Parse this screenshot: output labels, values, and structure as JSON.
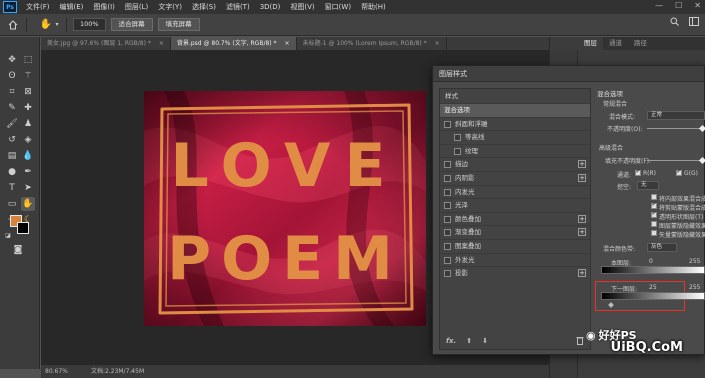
{
  "menubar": {
    "logo": "Ps",
    "items": [
      "文件(F)",
      "编辑(E)",
      "图像(I)",
      "图层(L)",
      "文字(Y)",
      "选择(S)",
      "滤镜(T)",
      "3D(D)",
      "视图(V)",
      "窗口(W)",
      "帮助(H)"
    ],
    "controls": [
      "—",
      "☐",
      "✕"
    ]
  },
  "options": {
    "zoom_value": "100%",
    "fit_screen": "适合屏幕",
    "fill_screen": "填充屏幕"
  },
  "tabs": [
    {
      "label": "美女.jpg @ 97.6% (图层 1, RGB/8) *",
      "close": "×",
      "active": false
    },
    {
      "label": "背景.psd @ 80.7% (文字, RGB/8) *",
      "close": "×",
      "active": true
    },
    {
      "label": "未标题-1 @ 100% (Lorem Ipsum, RGB/8) *",
      "close": "×",
      "active": false
    }
  ],
  "artwork": {
    "line1": "LOVE",
    "line2": "POEM",
    "text_color": "#e08c45",
    "bg_color": "#b3163a"
  },
  "status": {
    "zoom": "80.67%",
    "doc": "文档:2.23M/7.45M"
  },
  "rightpanel": {
    "tabs": [
      "图层",
      "通道",
      "路径"
    ]
  },
  "dialog": {
    "title": "图层样式",
    "list_header": "样式",
    "items": [
      {
        "label": "混合选项",
        "checkbox": false,
        "plus": false,
        "selected": true,
        "indent": 0
      },
      {
        "label": "斜面和浮雕",
        "checkbox": true,
        "plus": false,
        "selected": false,
        "indent": 0
      },
      {
        "label": "等高线",
        "checkbox": true,
        "plus": false,
        "selected": false,
        "indent": 1
      },
      {
        "label": "纹理",
        "checkbox": true,
        "plus": false,
        "selected": false,
        "indent": 1
      },
      {
        "label": "描边",
        "checkbox": true,
        "plus": true,
        "selected": false,
        "indent": 0
      },
      {
        "label": "内阴影",
        "checkbox": true,
        "plus": true,
        "selected": false,
        "indent": 0
      },
      {
        "label": "内发光",
        "checkbox": true,
        "plus": false,
        "selected": false,
        "indent": 0
      },
      {
        "label": "光泽",
        "checkbox": true,
        "plus": false,
        "selected": false,
        "indent": 0
      },
      {
        "label": "颜色叠加",
        "checkbox": true,
        "plus": true,
        "selected": false,
        "indent": 0
      },
      {
        "label": "渐变叠加",
        "checkbox": true,
        "plus": true,
        "selected": false,
        "indent": 0
      },
      {
        "label": "图案叠加",
        "checkbox": true,
        "plus": false,
        "selected": false,
        "indent": 0
      },
      {
        "label": "外发光",
        "checkbox": true,
        "plus": false,
        "selected": false,
        "indent": 0
      },
      {
        "label": "投影",
        "checkbox": true,
        "plus": true,
        "selected": false,
        "indent": 0
      }
    ],
    "bottom": {
      "fx": "fx.",
      "up": "⬆",
      "down": "⬇",
      "trash": "🗑"
    },
    "blend": {
      "section": "混合选项",
      "general": "常规混合",
      "mode_label": "混合模式:",
      "mode_value": "正常",
      "opacity_label": "不透明度(O):",
      "advanced": "高级混合",
      "fill_label": "填充不透明度(F):",
      "channels_label": "通道:",
      "channel_r": "R(R)",
      "channel_g": "G(G)",
      "knockout_label": "挖空:",
      "knockout_value": "无",
      "options": [
        "将内部效果混合成",
        "将剪贴蒙版混合成",
        "透明形状图层(T)",
        "图层蒙版隐藏效果",
        "矢量蒙版隐藏效果"
      ],
      "options_checked": [
        false,
        true,
        true,
        false,
        false
      ],
      "blend_if_label": "混合颜色带:",
      "blend_if_value": "灰色",
      "this_layer_label": "本图层:",
      "this_layer_low": "0",
      "this_layer_high": "255",
      "under_layer_label": "下一图层:",
      "under_layer_low": "25",
      "under_layer_high": "255"
    }
  },
  "watermark": {
    "brand": "好好PS",
    "site": "UiBQ.CoM"
  }
}
